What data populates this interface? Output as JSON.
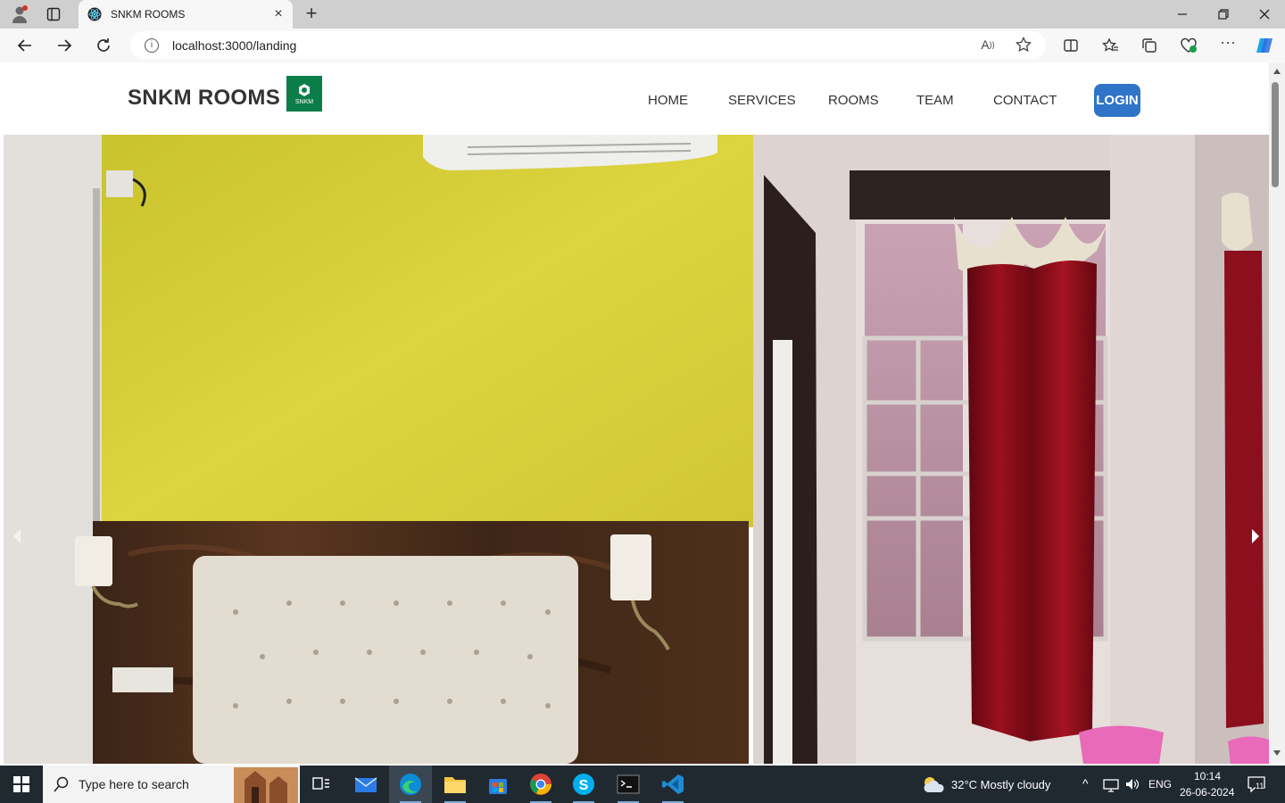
{
  "browser": {
    "tab_title": "SNKM ROOMS",
    "url": "localhost:3000/landing"
  },
  "site": {
    "brand": "SNKM ROOMS",
    "logo_text": "SNKM",
    "nav": [
      "HOME",
      "SERVICES",
      "ROOMS",
      "TEAM",
      "CONTACT"
    ],
    "login_label": "LOGIN",
    "colors": {
      "login_bg": "#2f74c6",
      "logo_bg": "#0b7d49"
    }
  },
  "taskbar": {
    "search_placeholder": "Type here to search",
    "weather": "32°C  Mostly cloudy",
    "language": "ENG",
    "time": "10:14",
    "date": "26-06-2024",
    "notifications": "11"
  }
}
